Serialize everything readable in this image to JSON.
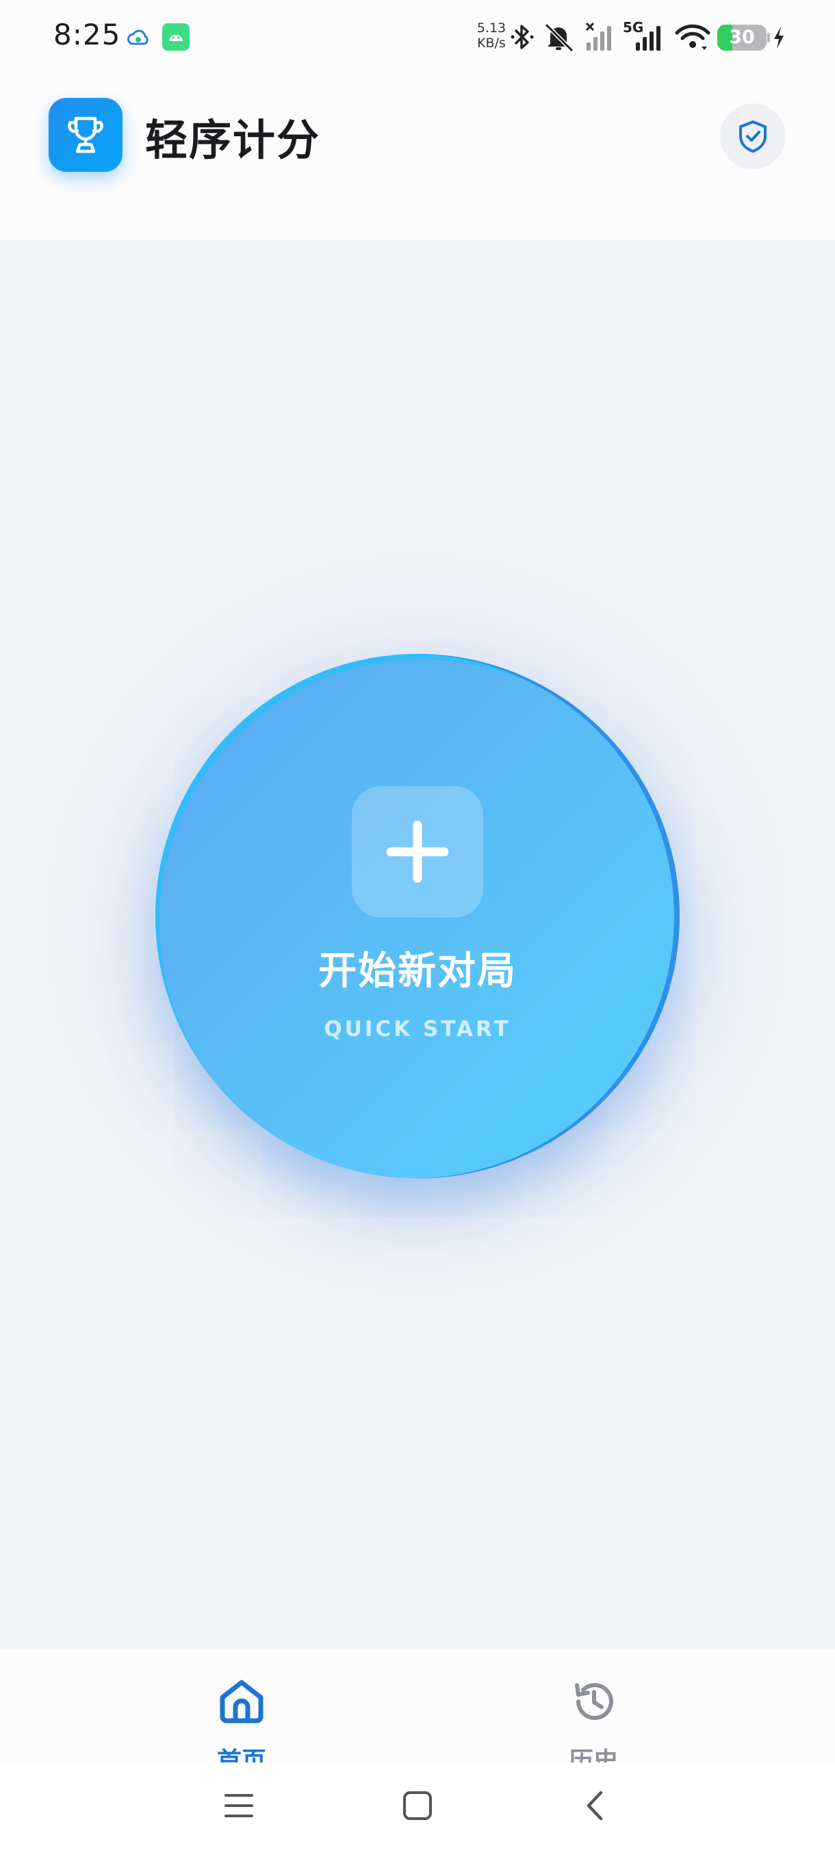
{
  "status_bar": {
    "time": "8:25",
    "net_speed_value": "5.13",
    "net_speed_unit": "KB/s",
    "network_type": "5G",
    "battery_level": "30",
    "icons": [
      "cloud-icon",
      "android-app-icon",
      "bluetooth-icon",
      "bell-muted-icon",
      "signal-icon",
      "signal-5g-icon",
      "wifi-icon",
      "battery-icon",
      "charging-icon"
    ]
  },
  "header": {
    "title": "轻序计分",
    "logo_icon": "trophy-icon",
    "action_icon": "shield-check-icon"
  },
  "main": {
    "start_button": {
      "label": "开始新对局",
      "sublabel": "QUICK START",
      "icon": "plus-icon"
    }
  },
  "bottom_nav": {
    "items": [
      {
        "label": "首页",
        "icon": "home-icon",
        "active": true
      },
      {
        "label": "历史",
        "icon": "history-icon",
        "active": false
      }
    ]
  },
  "system_nav": {
    "icons": [
      "menu-icon",
      "home-square-icon",
      "back-icon"
    ]
  },
  "colors": {
    "accent": "#1d73d6",
    "button_start": "#5aa7ef",
    "button_end": "#55d0fd",
    "background": "#f3f4f7",
    "inactive": "#8d9096"
  }
}
